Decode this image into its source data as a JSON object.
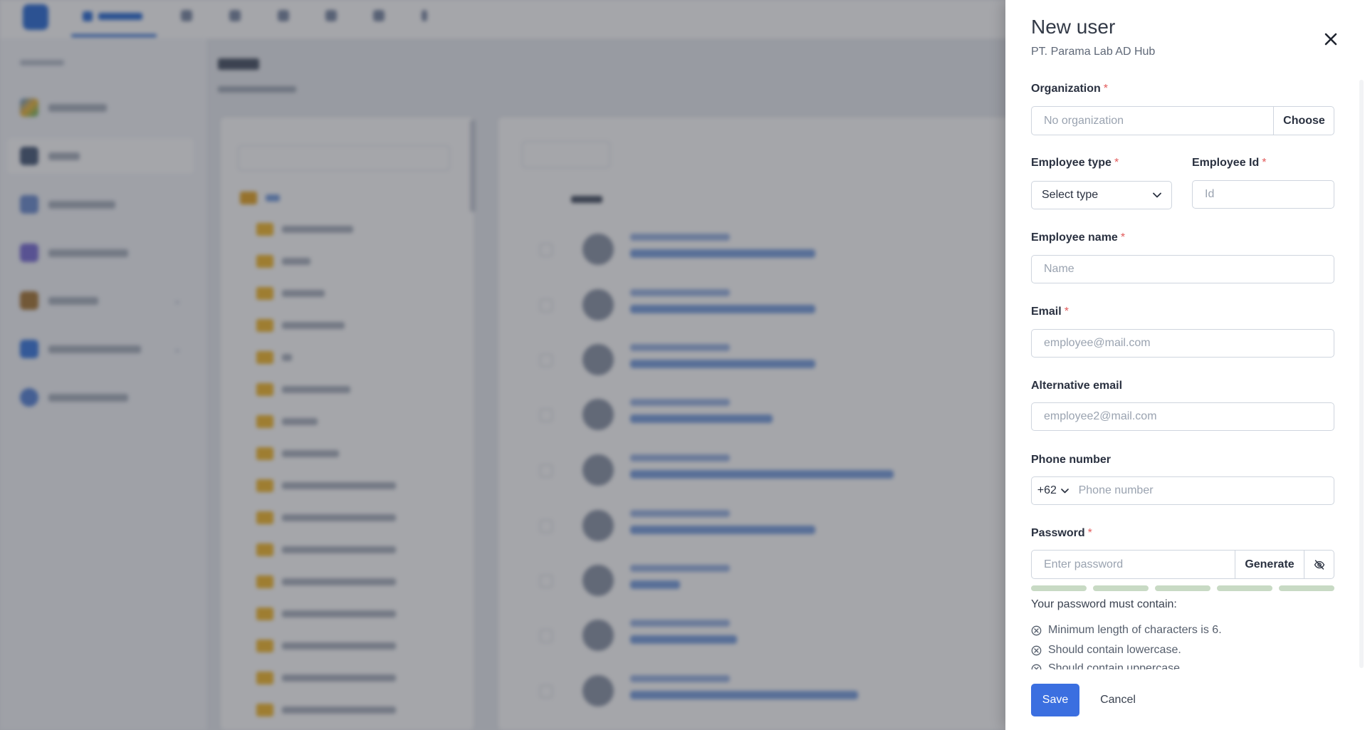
{
  "drawer": {
    "title": "New user",
    "subtitle": "PT. Parama Lab AD Hub",
    "organization": {
      "label": "Organization",
      "placeholder": "No organization",
      "choose_label": "Choose"
    },
    "employee_type": {
      "label": "Employee type",
      "value": "Select type"
    },
    "employee_id": {
      "label": "Employee Id",
      "placeholder": "Id"
    },
    "employee_name": {
      "label": "Employee name",
      "placeholder": "Name"
    },
    "email": {
      "label": "Email",
      "placeholder": "employee@mail.com"
    },
    "alt_email": {
      "label": "Alternative email",
      "placeholder": "employee2@mail.com"
    },
    "phone": {
      "label": "Phone number",
      "country_code": "+62",
      "placeholder": "Phone number"
    },
    "password": {
      "label": "Password",
      "placeholder": "Enter password",
      "generate_label": "Generate",
      "requirements_intro": "Your password must contain:",
      "requirements": [
        "Minimum length of characters is 6.",
        "Should contain lowercase.",
        "Should contain uppercase."
      ]
    },
    "required_marker": "*",
    "save_label": "Save",
    "cancel_label": "Cancel"
  },
  "colors": {
    "primary": "#3b6fe0",
    "required": "#e25b5b",
    "strength_bar": "#c8dac4",
    "overlay": "rgba(40,44,52,0.42)"
  },
  "icons": {
    "close": "close-icon",
    "select_chevron": "chevron-down-icon",
    "password_toggle": "eye-off-icon",
    "requirement_status": "circle-x-icon"
  }
}
